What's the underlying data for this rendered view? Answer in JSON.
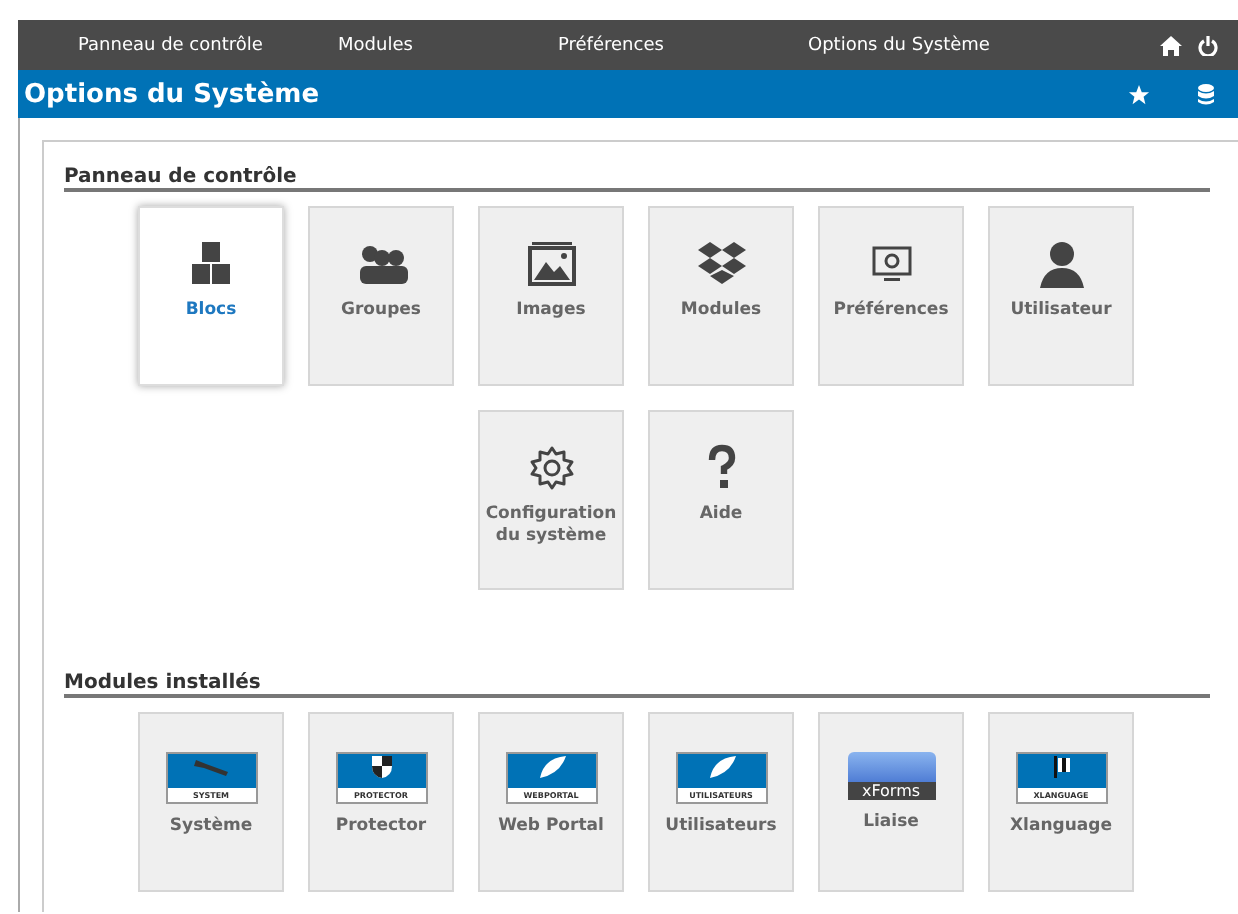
{
  "top_menu": [
    {
      "label": "Panneau de contrôle"
    },
    {
      "label": "Modules"
    },
    {
      "label": "Préférences"
    },
    {
      "label": "Options du Système"
    }
  ],
  "header": {
    "title": "Options du Système"
  },
  "sections": [
    {
      "title": "Panneau de contrôle",
      "tiles": [
        {
          "label": "Blocs",
          "kind": "blocks",
          "selected": true
        },
        {
          "label": "Groupes",
          "kind": "groups",
          "selected": false
        },
        {
          "label": "Images",
          "kind": "images",
          "selected": false
        },
        {
          "label": "Modules",
          "kind": "modules",
          "selected": false
        },
        {
          "label": "Préférences",
          "kind": "prefs",
          "selected": false
        },
        {
          "label": "Utilisateur",
          "kind": "user",
          "selected": false
        },
        {
          "label": "Configuration du système",
          "kind": "gear",
          "selected": false
        },
        {
          "label": "Aide",
          "kind": "help",
          "selected": false
        }
      ]
    },
    {
      "title": "Modules installés",
      "tiles": [
        {
          "label": "Système",
          "kind": "wrench",
          "logo_text": "SYSTEM",
          "selected": false
        },
        {
          "label": "Protector",
          "kind": "shield",
          "logo_text": "PROTECTOR",
          "selected": false
        },
        {
          "label": "Web Portal",
          "kind": "leaf",
          "logo_text": "WEBPORTAL",
          "selected": false
        },
        {
          "label": "Utilisateurs",
          "kind": "leaf",
          "logo_text": "UTILISATEURS",
          "selected": false
        },
        {
          "label": "Liaise",
          "kind": "xforms",
          "logo_text": "xForms",
          "selected": false
        },
        {
          "label": "Xlanguage",
          "kind": "flag",
          "logo_text": "XLANGUAGE",
          "selected": false
        }
      ]
    }
  ]
}
